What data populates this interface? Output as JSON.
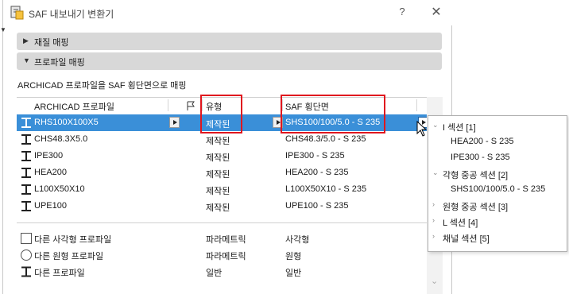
{
  "window": {
    "title": "SAF 내보내기 변환기",
    "help_label": "?",
    "close_label": "✕"
  },
  "sections": {
    "material_mapping": "재질 매핑",
    "profile_mapping": "프로파일 매핑"
  },
  "description": "ARCHICAD 프로파일을 SAF 횡단면으로 매핑",
  "table": {
    "columns": {
      "archicad_profile": "ARCHICAD 프로파일",
      "type": "유형",
      "saf_section": "SAF 횡단면"
    },
    "rows": [
      {
        "name": "RHS100X100X5",
        "type": "제작된",
        "saf": "SHS100/100/5.0 - S 235",
        "selected": true
      },
      {
        "name": "CHS48.3X5.0",
        "type": "제작된",
        "saf": "CHS48.3/5.0 - S 235"
      },
      {
        "name": "IPE300",
        "type": "제작된",
        "saf": "IPE300 - S 235"
      },
      {
        "name": "HEA200",
        "type": "제작된",
        "saf": "HEA200 - S 235"
      },
      {
        "name": "L100X50X10",
        "type": "제작된",
        "saf": "L100X50X10 - S 235"
      },
      {
        "name": "UPE100",
        "type": "제작된",
        "saf": "UPE100 - S 235"
      }
    ],
    "generic_rows": [
      {
        "name": "다른 사각형 프로파일",
        "type": "파라메트릭",
        "saf": "사각형"
      },
      {
        "name": "다른 원형 프로파일",
        "type": "파라메트릭",
        "saf": "원형"
      },
      {
        "name": "다른 프로파일",
        "type": "일반",
        "saf": "일반"
      }
    ]
  },
  "popup": {
    "items": [
      {
        "label": "I 섹션 [1]",
        "level": 0,
        "expanded": true
      },
      {
        "label": "HEA200 - S 235",
        "level": 1
      },
      {
        "label": "IPE300 - S 235",
        "level": 1
      },
      {
        "label": "각형 중공 섹션 [2]",
        "level": 0,
        "expanded": true
      },
      {
        "label": "SHS100/100/5.0 - S 235",
        "level": 1
      },
      {
        "label": "원형 중공 섹션 [3]",
        "level": 0,
        "expanded": false
      },
      {
        "label": "L 섹션 [4]",
        "level": 0,
        "expanded": false
      },
      {
        "label": "채널 섹션 [5]",
        "level": 0,
        "expanded": false
      }
    ]
  },
  "colors": {
    "selection": "#3a8fd8",
    "highlight": "#e0161e",
    "section_header": "#d8d8d8"
  }
}
